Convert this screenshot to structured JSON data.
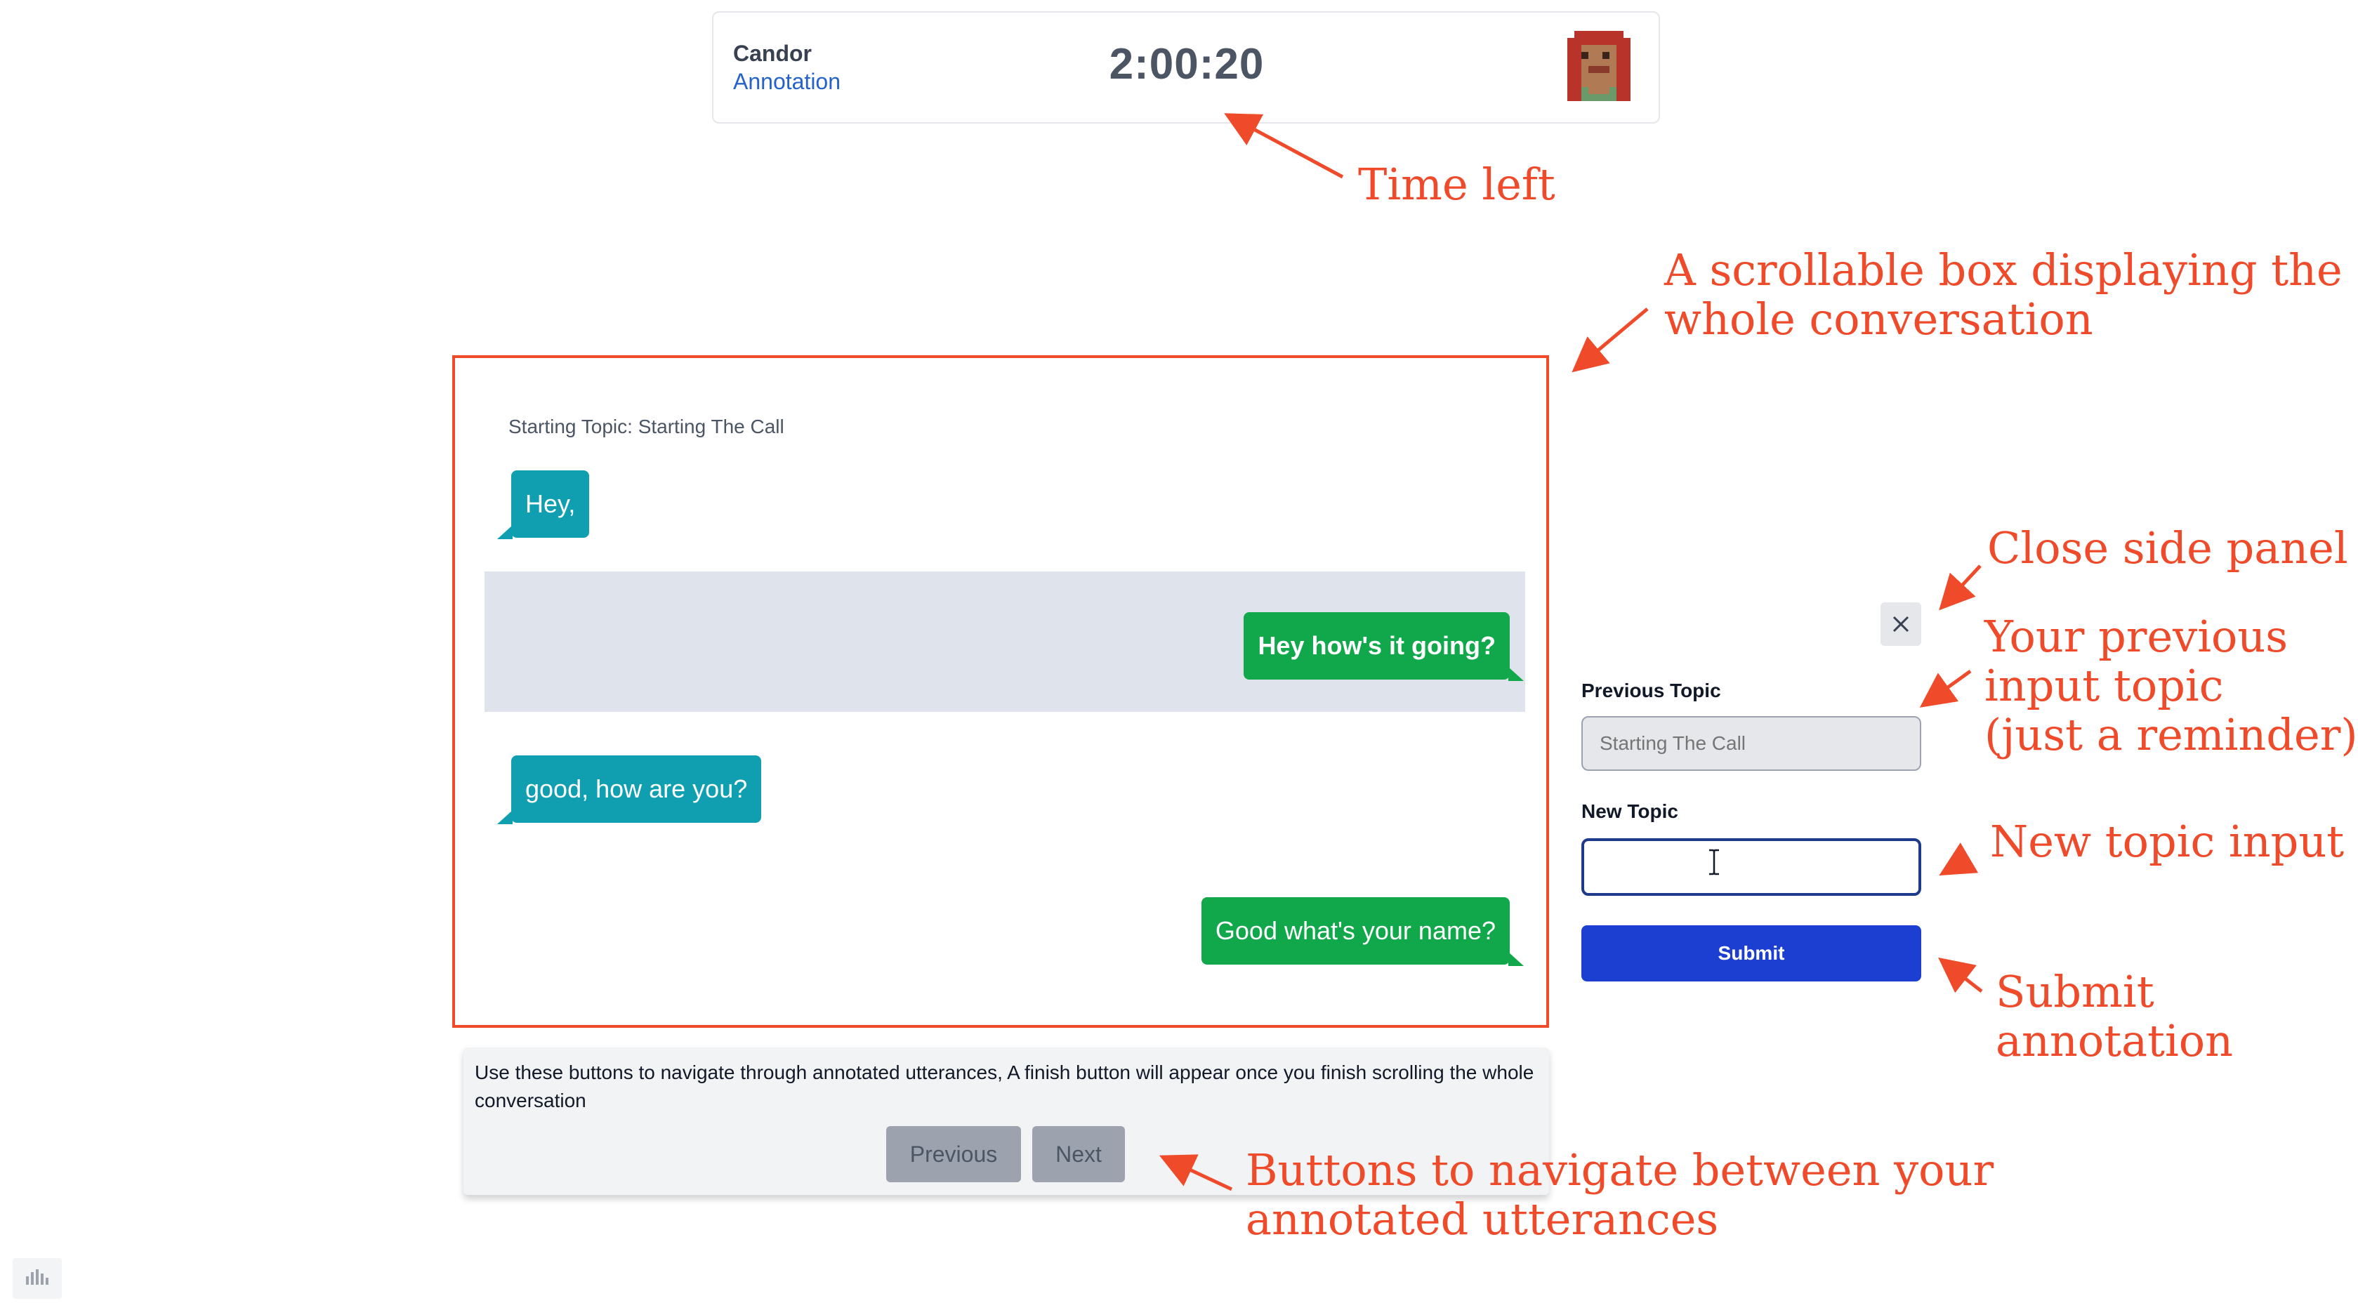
{
  "header": {
    "brand_name": "Candor",
    "brand_sub": "Annotation",
    "timer": "2:00:20",
    "avatar_icon": "pixel-avatar-icon"
  },
  "conversation": {
    "starting_topic": "Starting Topic: Starting The Call",
    "messages": [
      {
        "side": "left",
        "text": "Hey,"
      },
      {
        "side": "right",
        "text": "Hey how's it going?",
        "highlighted": true
      },
      {
        "side": "left",
        "text": "good, how are you?"
      },
      {
        "side": "right",
        "text": "Good what's your name?"
      }
    ]
  },
  "nav": {
    "instructions": "Use these buttons to navigate through annotated utterances, A finish button will appear once you finish scrolling the whole conversation",
    "previous_label": "Previous",
    "next_label": "Next"
  },
  "side_panel": {
    "close_icon": "close-icon",
    "previous_topic_label": "Previous Topic",
    "previous_topic_value": "Starting The Call",
    "new_topic_label": "New Topic",
    "new_topic_value": "",
    "submit_label": "Submit"
  },
  "annotations": {
    "time_left": "Time left",
    "scrollable_box": "A scrollable box displaying the\nwhole conversation",
    "close_panel": "Close side panel",
    "previous_input": "Your previous\ninput topic\n(just a reminder)",
    "new_topic_input": "New topic input",
    "submit": "Submit\nannotation",
    "navigate": "Buttons to navigate between your\nannotated utterances"
  },
  "colors": {
    "annotation": "#ef4a2a",
    "left_bubble": "#0f9fb0",
    "right_bubble": "#11a84b",
    "submit": "#1d3fd1",
    "brand_sub": "#2563c9"
  }
}
